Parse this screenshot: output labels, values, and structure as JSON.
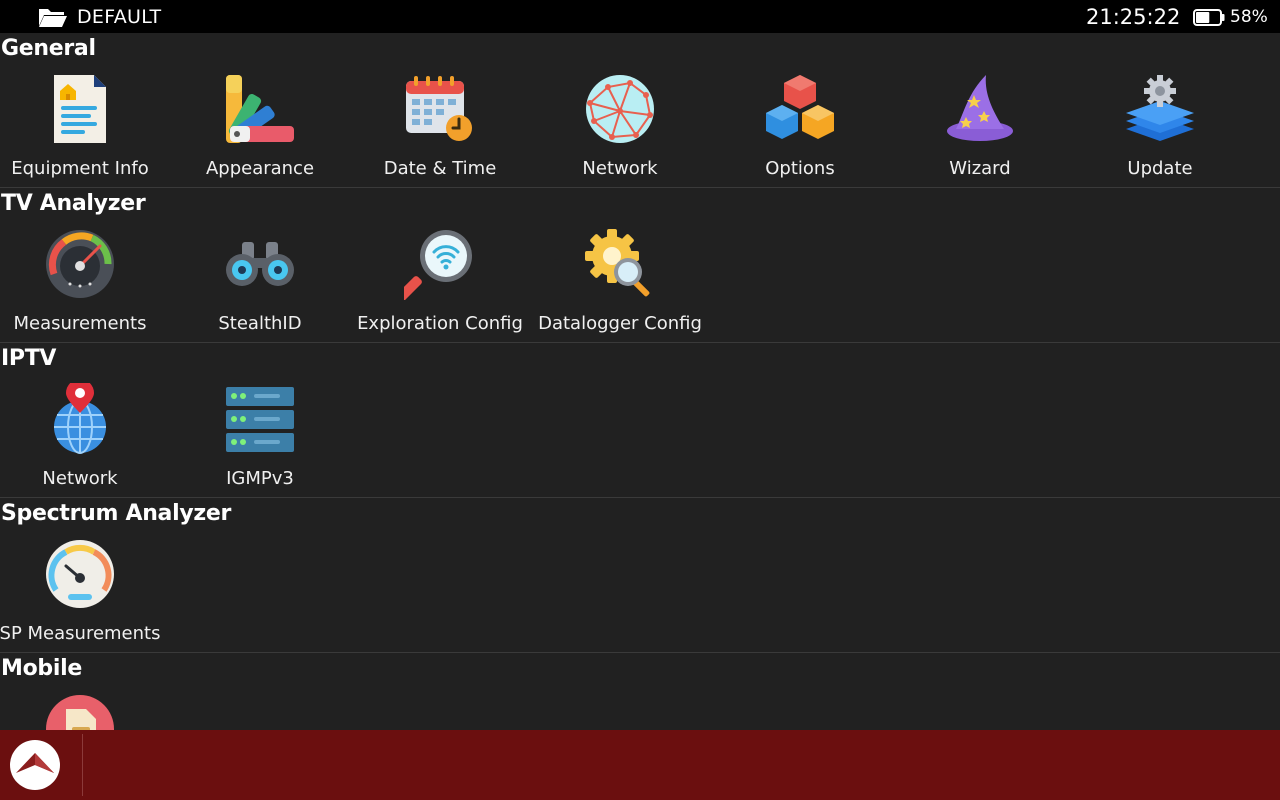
{
  "status_bar": {
    "profile_name": "DEFAULT",
    "time": "21:25:22",
    "battery_percent": "58%",
    "battery_level": 0.58
  },
  "sections": [
    {
      "title": "General",
      "items": [
        {
          "label": "Equipment Info",
          "icon": "equipment-info-icon"
        },
        {
          "label": "Appearance",
          "icon": "appearance-palette-icon"
        },
        {
          "label": "Date & Time",
          "icon": "calendar-clock-icon"
        },
        {
          "label": "Network",
          "icon": "globe-network-icon"
        },
        {
          "label": "Options",
          "icon": "cubes-options-icon"
        },
        {
          "label": "Wizard",
          "icon": "wizard-hat-icon"
        },
        {
          "label": "Update",
          "icon": "layers-gear-update-icon"
        }
      ]
    },
    {
      "title": "TV Analyzer",
      "items": [
        {
          "label": "Measurements",
          "icon": "gauge-icon"
        },
        {
          "label": "StealthID",
          "icon": "binoculars-icon"
        },
        {
          "label": "Exploration Config",
          "icon": "magnifier-wifi-icon"
        },
        {
          "label": "Datalogger Config",
          "icon": "gear-magnifier-icon"
        }
      ]
    },
    {
      "title": "IPTV",
      "items": [
        {
          "label": "Network",
          "icon": "globe-pin-icon"
        },
        {
          "label": "IGMPv3",
          "icon": "server-stack-icon"
        }
      ]
    },
    {
      "title": "Spectrum Analyzer",
      "items": [
        {
          "label": "SP Measurements",
          "icon": "speedometer-icon"
        }
      ]
    },
    {
      "title": "Mobile",
      "items": [
        {
          "label": "",
          "icon": "sim-card-icon"
        }
      ]
    }
  ],
  "colors": {
    "background": "#212121",
    "top_bar": "#000000",
    "footer": "#6b0f0f"
  }
}
